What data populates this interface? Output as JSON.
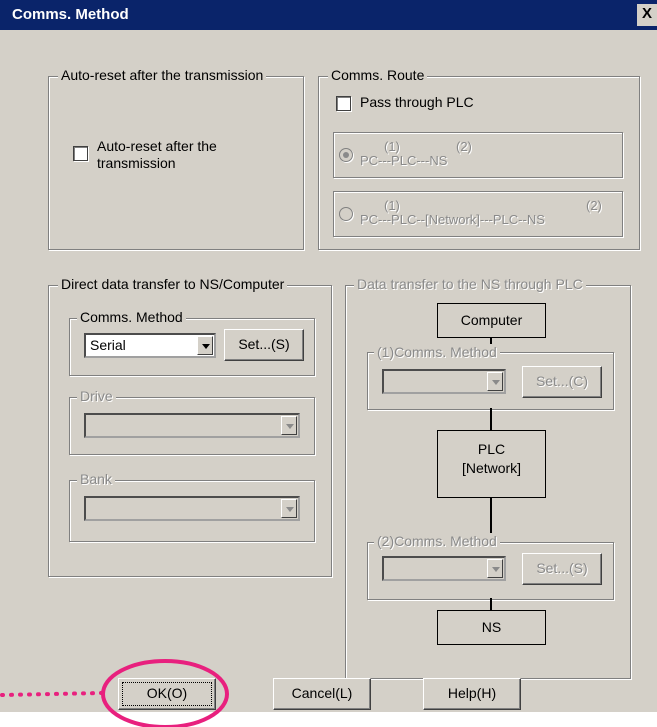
{
  "window": {
    "title": "Comms. Method",
    "close_label": "X"
  },
  "auto_reset_group": {
    "legend": "Auto-reset after the transmission",
    "checkbox_label_line1": "Auto-reset after the",
    "checkbox_label_line2": "transmission",
    "checked": false
  },
  "comms_route": {
    "legend": "Comms. Route",
    "pass_through_label": "Pass through PLC",
    "option1": {
      "num1": "(1)",
      "num2": "(2)",
      "text": "PC---PLC---NS",
      "selected": true
    },
    "option2": {
      "num1": "(1)",
      "num2": "(2)",
      "text": "PC---PLC--[Network]---PLC--NS",
      "selected": false
    }
  },
  "direct_transfer": {
    "legend": "Direct data transfer to NS/Computer",
    "method_legend": "Comms. Method",
    "method_value": "Serial",
    "set_button": "Set...(S)",
    "drive_legend": "Drive",
    "bank_legend": "Bank"
  },
  "plc_transfer": {
    "legend": "Data transfer to the NS through PLC",
    "computer_label": "Computer",
    "method1_legend": "(1)Comms. Method",
    "set1_button": "Set...(C)",
    "plc_label_line1": "PLC",
    "plc_label_line2": "[Network]",
    "method2_legend": "(2)Comms. Method",
    "set2_button": "Set...(S)",
    "ns_label": "NS"
  },
  "footer": {
    "ok": "OK(O)",
    "cancel": "Cancel(L)",
    "help": "Help(H)"
  },
  "annotation_color": "#e8207e"
}
